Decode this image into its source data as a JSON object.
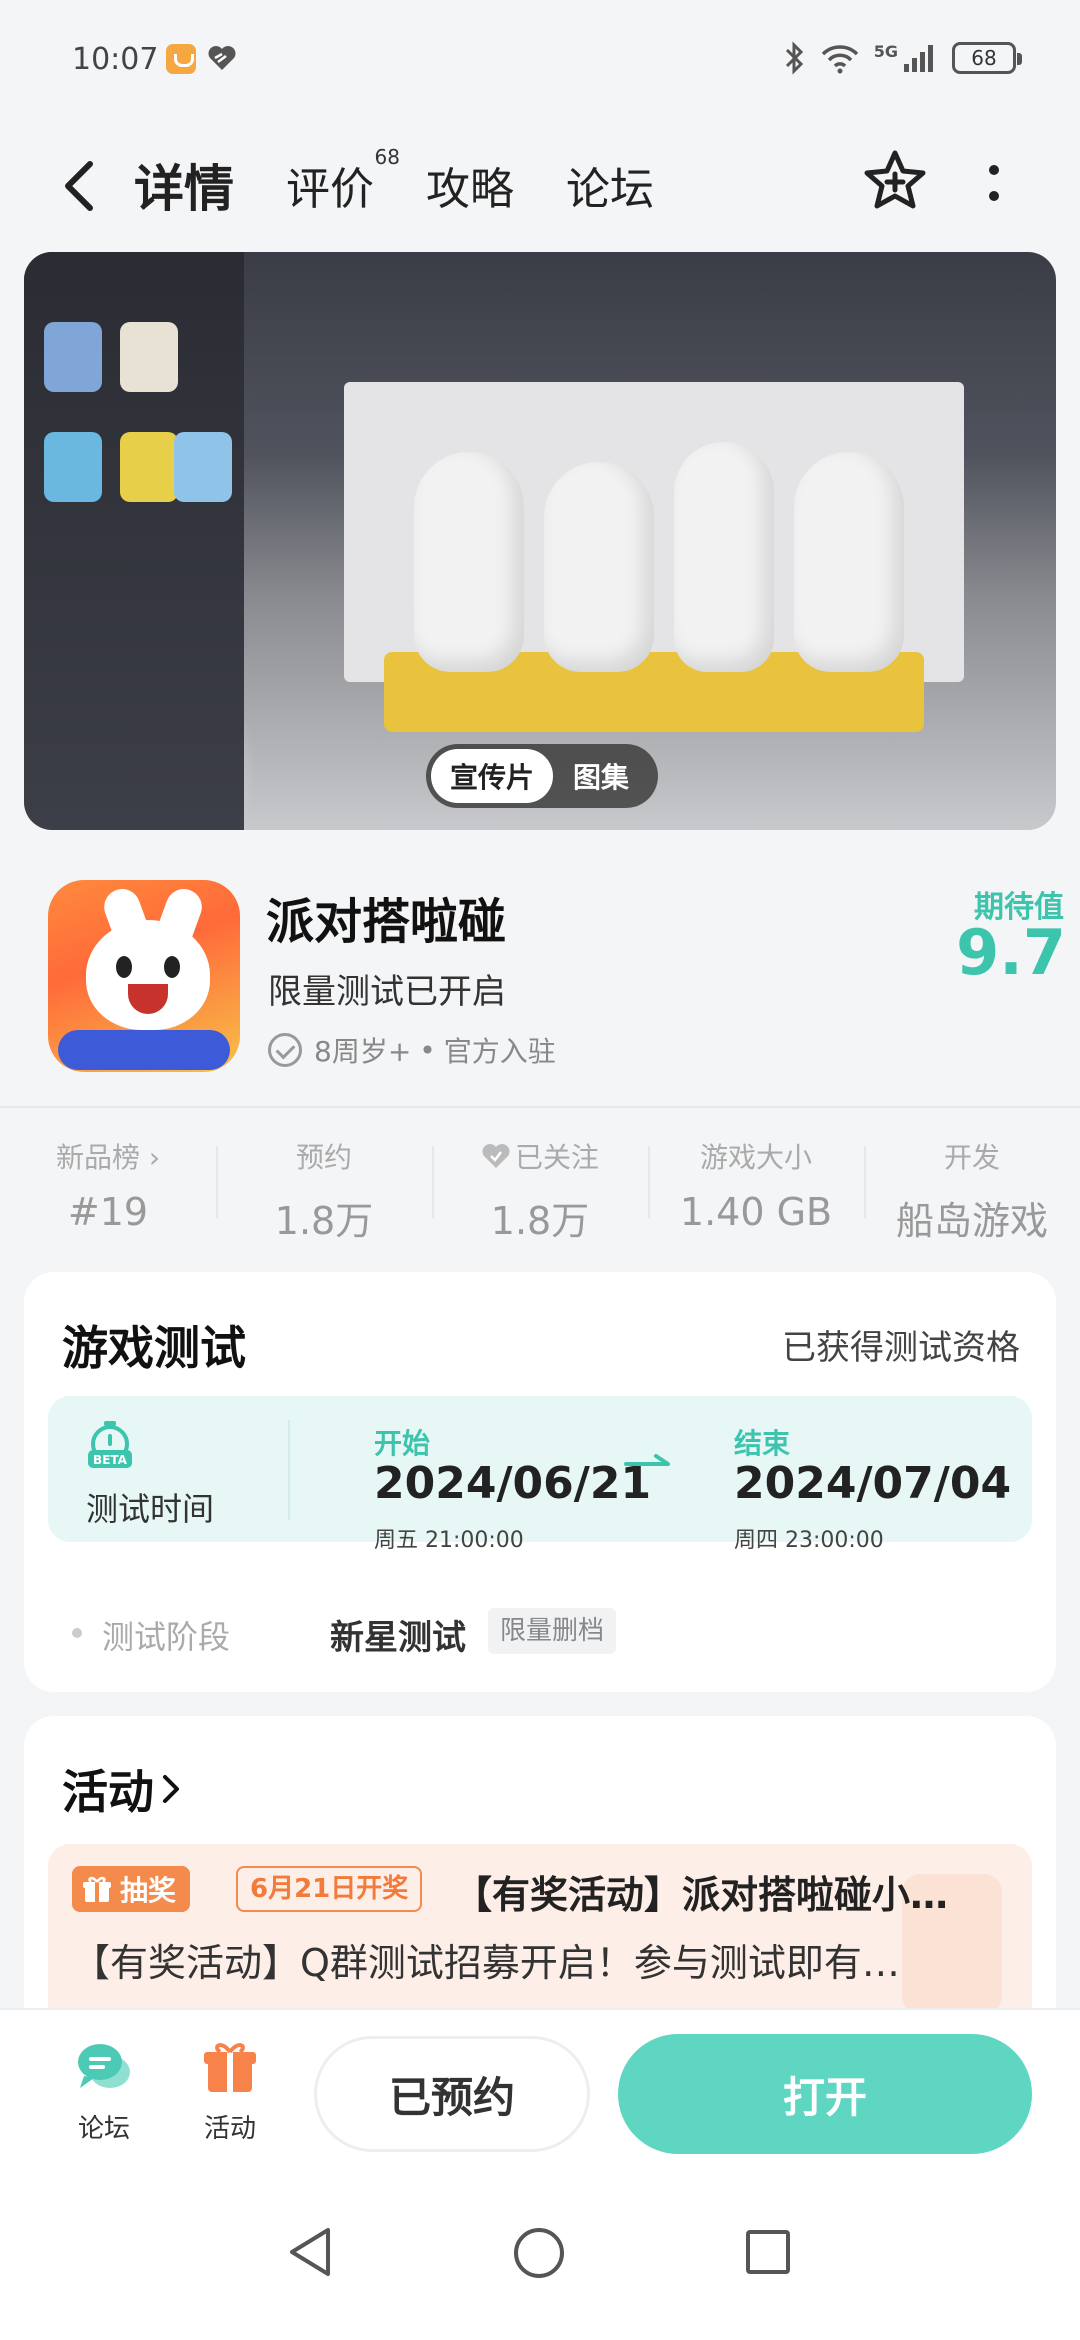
{
  "status_bar": {
    "time": "10:07",
    "signal_label": "5G",
    "battery": "68"
  },
  "nav": {
    "tabs": [
      {
        "label": "详情",
        "active": true
      },
      {
        "label": "评价",
        "badge": "68"
      },
      {
        "label": "攻略"
      },
      {
        "label": "论坛"
      }
    ]
  },
  "media": {
    "toggle_on": "宣传片",
    "toggle_off": "图集"
  },
  "game": {
    "title": "派对搭啦碰",
    "subtitle": "限量测试已开启",
    "age": "8周岁+",
    "meta_sep": "•",
    "official": "官方入驻",
    "rating_label": "期待值",
    "rating_value": "9.7"
  },
  "stats": [
    {
      "label": "新品榜 ›",
      "value": "#19"
    },
    {
      "label": "预约",
      "value": "1.8万"
    },
    {
      "label": "已关注",
      "value": "1.8万"
    },
    {
      "label": "游戏大小",
      "value": "1.40 GB"
    },
    {
      "label": "开发",
      "value": "船岛游戏"
    }
  ],
  "test_card": {
    "title": "游戏测试",
    "status": "已获得测试资格",
    "time_label": "测试时间",
    "beta_text": "BETA",
    "start_label": "开始",
    "start_date": "2024/06/21",
    "start_sub": "周五   21:00:00",
    "end_label": "结束",
    "end_date": "2024/07/04",
    "end_sub": "周四   23:00:00",
    "phase_label": "测试阶段",
    "phase_value": "新星测试",
    "phase_tag": "限量删档"
  },
  "activity": {
    "title": "活动",
    "badge": "抽奖",
    "date_badge": "6月21日开奖",
    "headline": "【有奖活动】派对搭啦碰小…",
    "desc": "【有奖活动】Q群测试招募开启！参与测试即有…"
  },
  "bottom_bar": {
    "forum_label": "论坛",
    "activity_label": "活动",
    "reserved_label": "已预约",
    "open_label": "打开"
  },
  "colors": {
    "accent": "#5fd6c2",
    "accent_text": "#3cc4ad",
    "lottery": "#f48a4c"
  }
}
